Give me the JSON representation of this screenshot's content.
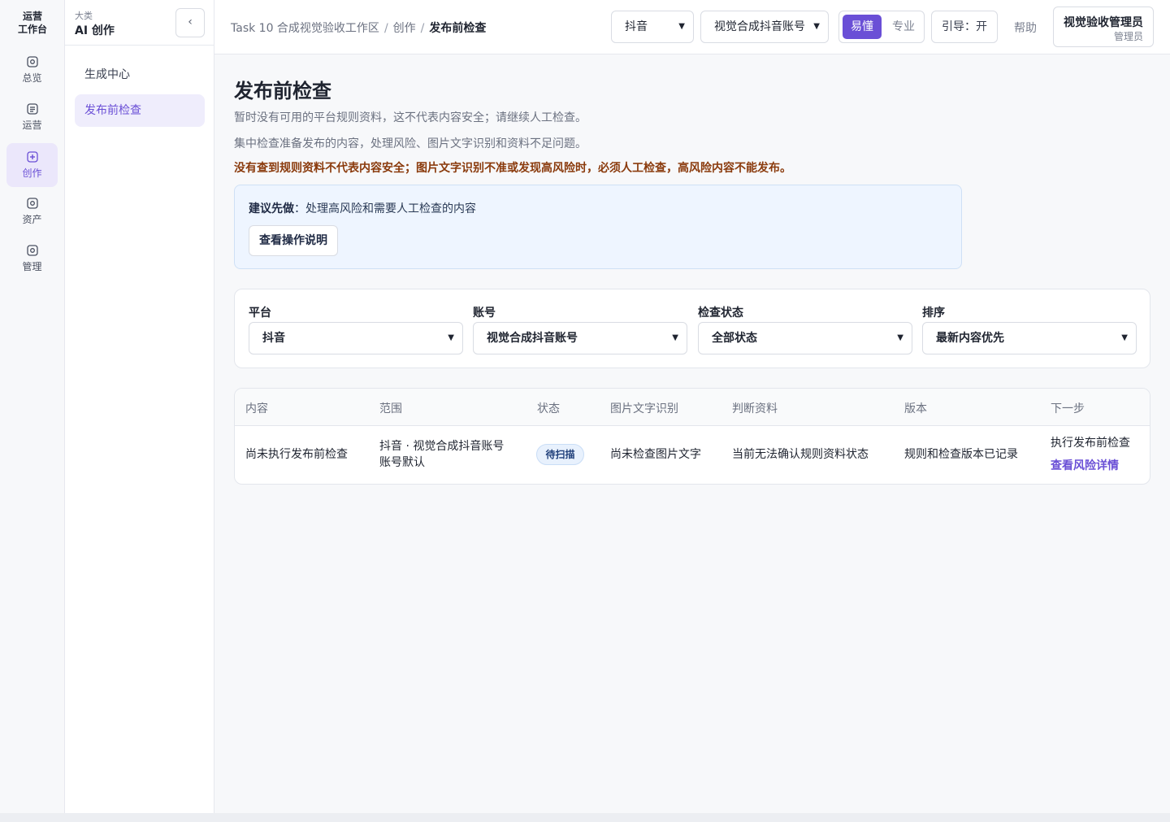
{
  "rail": {
    "brand_line1": "运营",
    "brand_line2": "工作台",
    "items": [
      {
        "label": "总览",
        "icon": "overview-icon"
      },
      {
        "label": "运营",
        "icon": "operations-icon"
      },
      {
        "label": "创作",
        "icon": "create-icon"
      },
      {
        "label": "资产",
        "icon": "assets-icon"
      },
      {
        "label": "管理",
        "icon": "admin-icon"
      }
    ]
  },
  "sidebar": {
    "category": "大类",
    "title": "AI 创作",
    "collapse_glyph": "‹",
    "items": [
      {
        "label": "生成中心"
      },
      {
        "label": "发布前检查"
      }
    ]
  },
  "topbar": {
    "breadcrumb": [
      "Task 10 合成视觉验收工作区",
      "创作",
      "发布前检查"
    ],
    "platform_select": "抖音",
    "account_select": "视觉合成抖音账号",
    "mode_easy": "易懂",
    "mode_pro": "专业",
    "guide": "引导：开",
    "help": "帮助",
    "user_name": "视觉验收管理员",
    "user_role": "管理员"
  },
  "main": {
    "title": "发布前检查",
    "note1": "暂时没有可用的平台规则资料，这不代表内容安全；请继续人工检查。",
    "note2": "集中检查准备发布的内容，处理风险、图片文字识别和资料不足问题。",
    "warning": "没有查到规则资料不代表内容安全；图片文字识别不准或发现高风险时，必须人工检查，高风险内容不能发布。",
    "tip_label": "建议先做",
    "tip_text": "处理高风险和需要人工检查的内容",
    "tip_button": "查看操作说明"
  },
  "filters": [
    {
      "label": "平台",
      "value": "抖音"
    },
    {
      "label": "账号",
      "value": "视觉合成抖音账号"
    },
    {
      "label": "检查状态",
      "value": "全部状态"
    },
    {
      "label": "排序",
      "value": "最新内容优先"
    }
  ],
  "table": {
    "headers": [
      "内容",
      "范围",
      "状态",
      "图片文字识别",
      "判断资料",
      "版本",
      "下一步"
    ],
    "row": {
      "content": "尚未执行发布前检查",
      "scope_line1": "抖音 · 视觉合成抖音账号",
      "scope_line2": "账号默认",
      "status": "待扫描",
      "ocr": "尚未检查图片文字",
      "basis": "当前无法确认规则资料状态",
      "version": "规则和检查版本已记录",
      "next_action": "执行发布前检查",
      "risk_link": "查看风险详情"
    }
  },
  "colors": {
    "accent": "#6a4fd6",
    "warning_text": "#8a3a0c",
    "tip_bg": "#eef5ff"
  }
}
